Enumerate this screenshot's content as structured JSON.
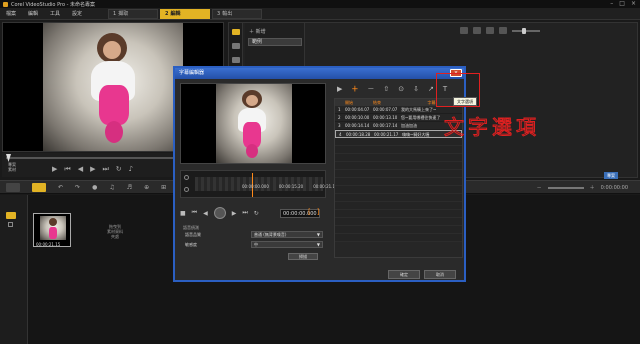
{
  "app": {
    "title": "Corel VideoStudio Pro - 未命名專案",
    "window_controls": [
      "–",
      "□",
      "×"
    ]
  },
  "menu": [
    "檔案",
    "編輯",
    "工具",
    "設定"
  ],
  "steps": [
    {
      "num": "1",
      "label": "擷取"
    },
    {
      "num": "2",
      "label": "編輯"
    },
    {
      "num": "3",
      "label": "輸出"
    }
  ],
  "preview": {
    "mode_labels": [
      "專案",
      "素材"
    ]
  },
  "library": {
    "add_label": "新增",
    "folder": "範例"
  },
  "timeline": {
    "clip_time": "00:00:21.15",
    "drop_hint": [
      "拖曳到",
      "素材資料",
      "夾處"
    ],
    "timecode": "0:00:00:00",
    "badge": "專案"
  },
  "dialog": {
    "title": "字幕編輯器",
    "close": "×",
    "tc_start": "00:00:00.000",
    "tc_mid": "00:00:15.20",
    "tc_end": "00:00:21.15",
    "tc_current": "00:00:00.000",
    "markers": [
      "[",
      "]"
    ],
    "section": "語音偵測",
    "row1_label": "語音品質",
    "row1_value": "普通 (無背景噪音)",
    "row2_label": "敏感度",
    "row2_value": "中",
    "scan": "掃描",
    "list_headers": {
      "no": "",
      "start": "開始",
      "end": "結束",
      "text": "字幕"
    },
    "rows": [
      {
        "no": "1",
        "start": "00:00:04.07",
        "end": "00:00:07.07",
        "text": "我的大馬騎上來了~"
      },
      {
        "no": "2",
        "start": "00:00:10.00",
        "end": "00:00:13.10",
        "text": "您~要用哪裡往快速了"
      },
      {
        "no": "3",
        "start": "00:00:14.14",
        "end": "00:00:17.14",
        "text": "加油加油"
      },
      {
        "no": "4",
        "start": "00:00:18.28",
        "end": "00:00:21.17",
        "text": "嗨嗨~騎好大喔"
      }
    ],
    "ok": "確定",
    "cancel": "取消"
  },
  "annotation": {
    "tooltip": "文字選項",
    "handwriting": "文字選項"
  }
}
